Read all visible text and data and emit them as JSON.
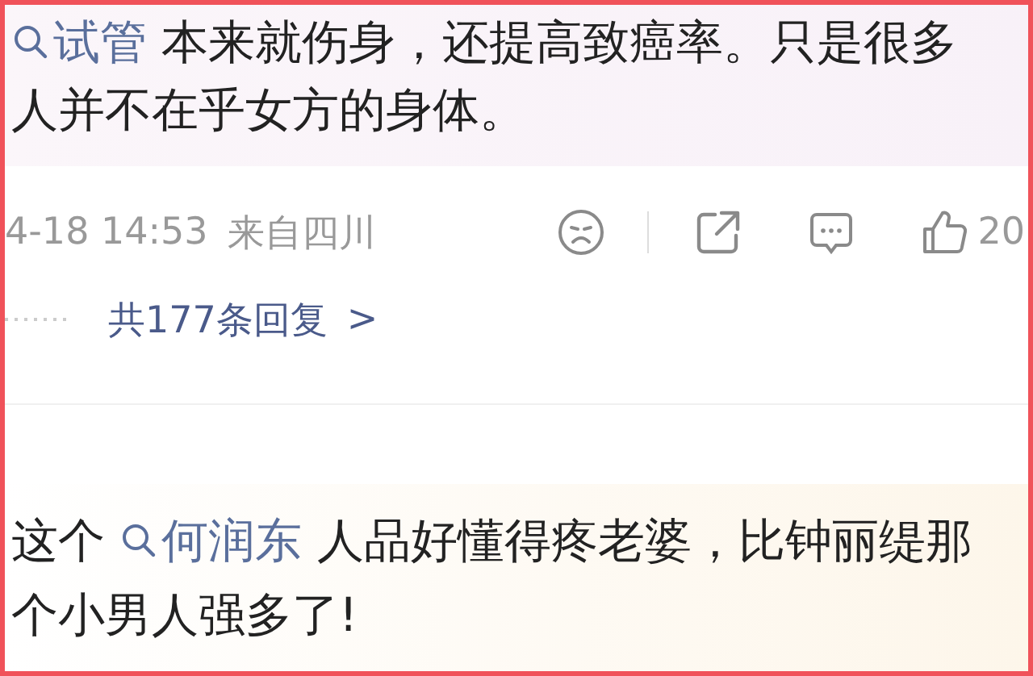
{
  "comments": [
    {
      "mention": "试管",
      "after": " 本来就伤身，还提高致癌率。只是很多",
      "next_line": "人并不在乎女方的身体。"
    },
    {
      "before": "这个 ",
      "mention": "何润东",
      "after": " 人品好懂得疼老婆，比钟丽缇那",
      "next_line": "个小男人强多了!"
    }
  ],
  "meta": {
    "time": "4-18 14:53",
    "location": "来自四川",
    "likes": "20"
  },
  "replies": {
    "label": "共177条回复",
    "chevron": ">"
  }
}
